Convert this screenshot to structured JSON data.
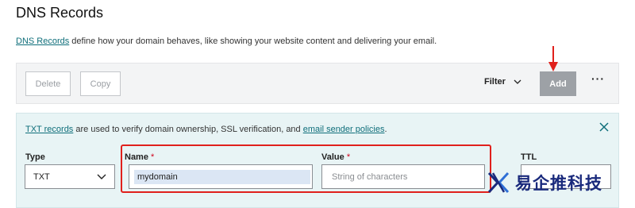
{
  "page": {
    "title": "DNS Records"
  },
  "intro": {
    "link": "DNS Records",
    "text": " define how your domain behaves, like showing your website content and delivering your email."
  },
  "toolbar": {
    "delete_label": "Delete",
    "copy_label": "Copy",
    "filter_label": "Filter",
    "add_label": "Add",
    "more_label": "···"
  },
  "txt_panel": {
    "link1": "TXT records",
    "text1": " are used to verify domain ownership, SSL verification, and ",
    "link2": "email sender policies",
    "text2": "."
  },
  "form": {
    "type_label": "Type",
    "type_value": "TXT",
    "name_label": "Name",
    "name_required": "*",
    "name_value": "mydomain",
    "value_label": "Value",
    "value_required": "*",
    "value_placeholder": "String of characters",
    "ttl_label": "TTL"
  },
  "watermark": {
    "text": "易企推科技"
  },
  "colors": {
    "link": "#0e6e7a",
    "add_button": "#9da1a6",
    "annotation_red": "#e0201c",
    "panel_bg": "#e8f4f5",
    "toolbar_bg": "#f3f4f5"
  },
  "icons": {
    "filter_chevron": "chevron-down-icon",
    "type_chevron": "chevron-down-icon",
    "close": "close-icon",
    "more": "more-icon",
    "arrow": "arrow-down-icon"
  }
}
